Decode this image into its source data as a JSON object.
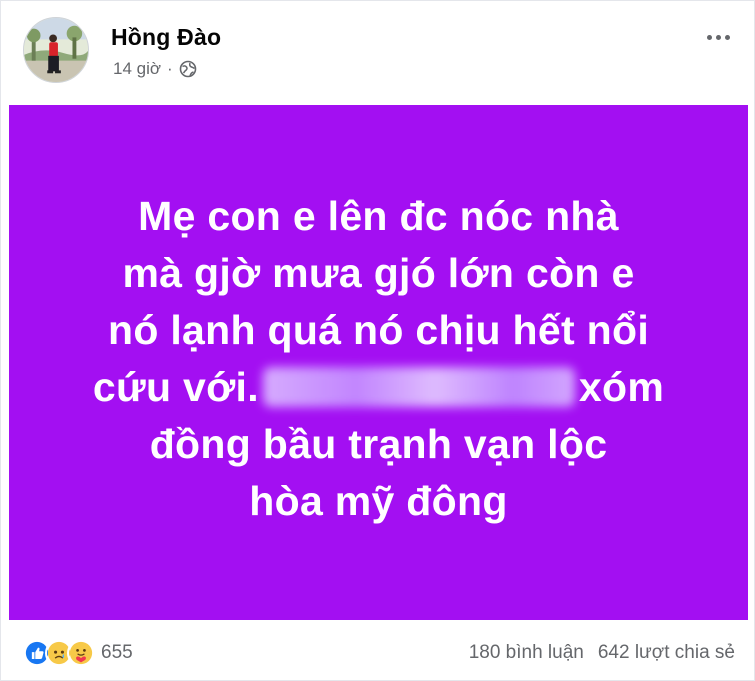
{
  "post": {
    "author": "Hồng Đào",
    "time": "14 giờ",
    "separator": "·",
    "privacy_icon": "globe-icon",
    "more_icon": "more-options-icon"
  },
  "banner": {
    "background": "#a30ff2",
    "text_color": "#ffffff",
    "line1": "Mẹ con e lên đc nóc nhà",
    "line2": "mà gjờ mưa gjó lớn còn e",
    "line3": "nó lạnh quá nó chịu hết nổi",
    "line4_before": "cứu với.",
    "line4_after": "xóm",
    "line5": "đồng bầu trạnh vạn lộc",
    "line6": "hòa mỹ đông"
  },
  "footer": {
    "reactions": [
      "like-icon",
      "sad-icon",
      "care-icon"
    ],
    "reaction_count": "655",
    "comments": "180 bình luận",
    "shares": "642 lượt chia sẻ"
  }
}
